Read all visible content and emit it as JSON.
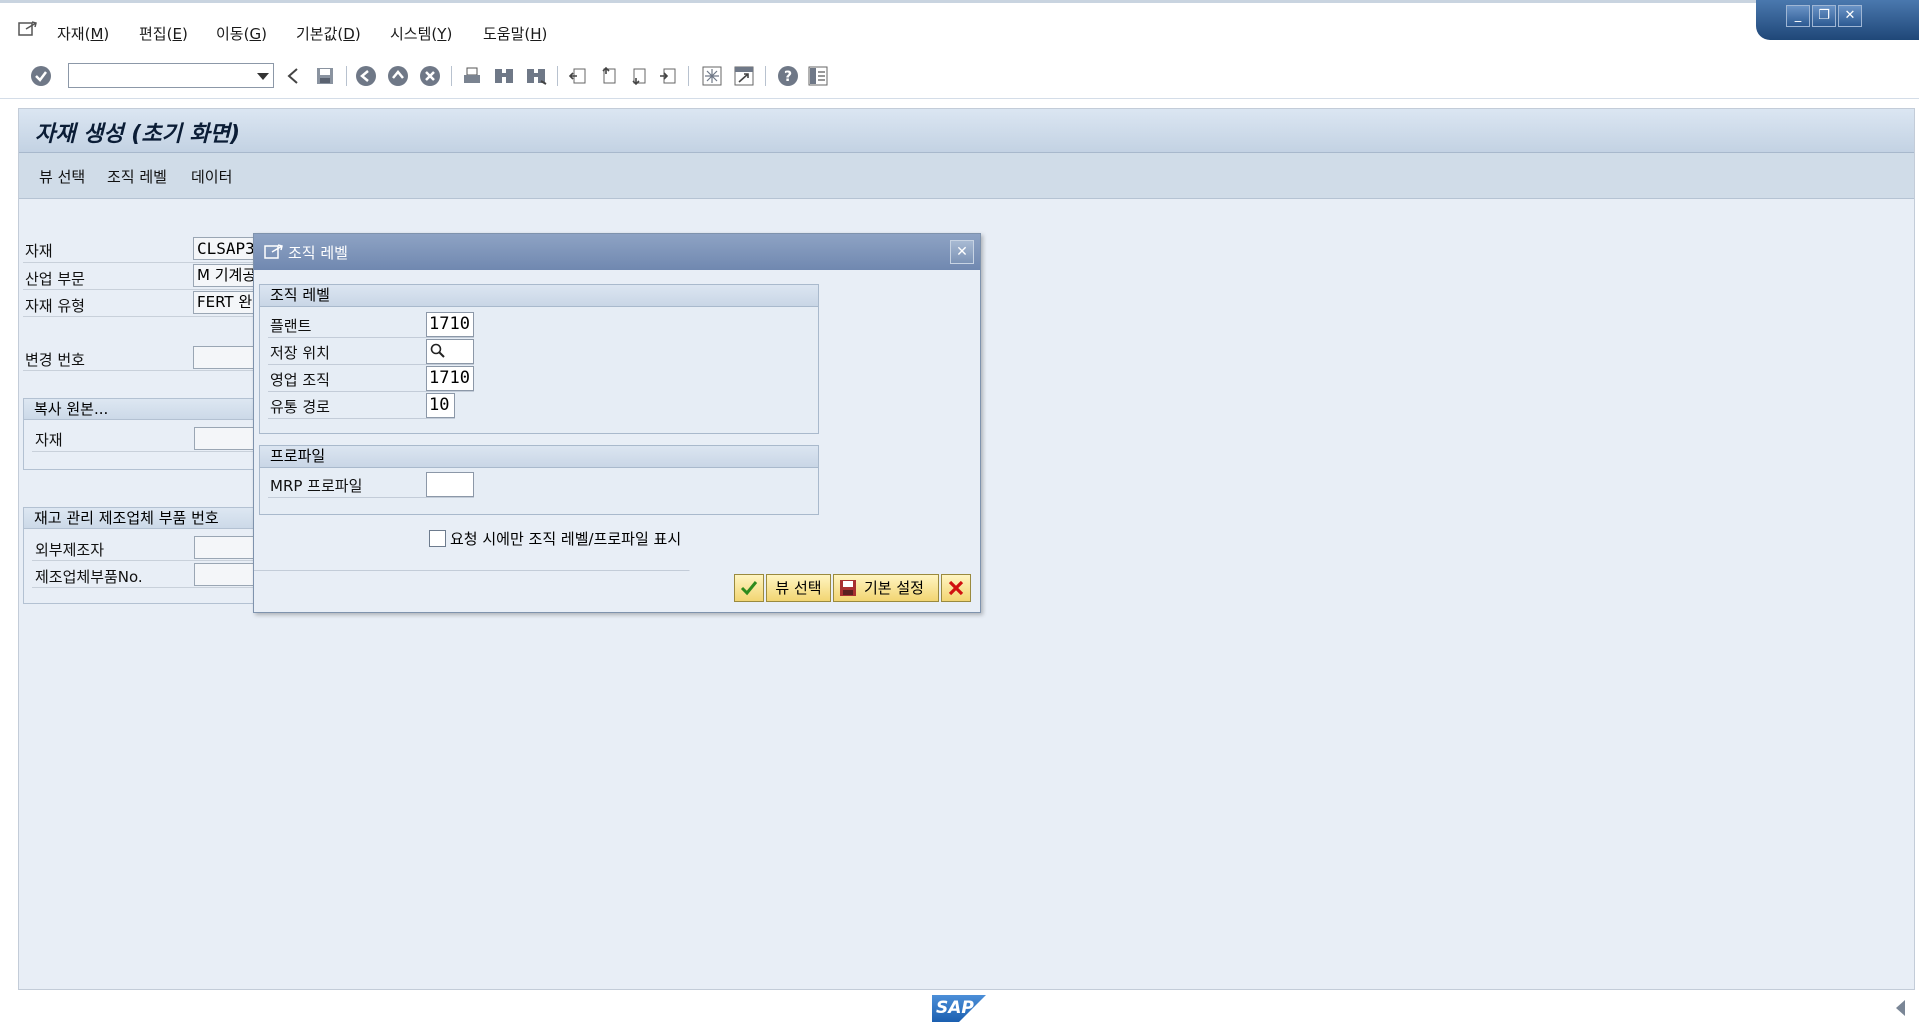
{
  "menu": {
    "items": [
      {
        "label": "자재(",
        "accel": "M",
        "end": ")"
      },
      {
        "label": "편집(",
        "accel": "E",
        "end": ")"
      },
      {
        "label": "이동(",
        "accel": "G",
        "end": ")"
      },
      {
        "label": "기본값(",
        "accel": "D",
        "end": ")"
      },
      {
        "label": "시스템(",
        "accel": "Y",
        "end": ")"
      },
      {
        "label": "도움말(",
        "accel": "H",
        "end": ")"
      }
    ]
  },
  "toolbar": {
    "command_field_value": "",
    "icons": [
      "enter-icon",
      "back-icon",
      "save-icon",
      "back-nav-icon",
      "exit-icon",
      "cancel-icon",
      "print-icon",
      "find-icon",
      "find-next-icon",
      "first-page-icon",
      "prev-page-icon",
      "next-page-icon",
      "last-page-icon",
      "new-session-icon",
      "shortcut-icon",
      "help-icon",
      "layout-icon"
    ]
  },
  "screen": {
    "title": "자재 생성 (초기 화면)",
    "app_toolbar": [
      "뷰 선택",
      "조직 레벨",
      "데이터"
    ]
  },
  "form": {
    "material_label": "자재",
    "material_value": "CLSAP3",
    "industry_label": "산업 부문",
    "industry_value": "M 기계공",
    "mat_type_label": "자재 유형",
    "mat_type_value": "FERT 완",
    "change_no_label": "변경 번호",
    "copy_group_title": "복사 원본...",
    "copy_material_label": "자재",
    "mpn_group_title": "재고 관리 제조업체 부품 번호",
    "ext_manufacturer_label": "외부제조자",
    "mfr_part_no_label": "제조업체부품No."
  },
  "dialog": {
    "title": "조직 레벨",
    "org_group_title": "조직 레벨",
    "plant_label": "플랜트",
    "plant_value": "1710",
    "storage_label": "저장 위치",
    "storage_value": "",
    "sales_org_label": "영업 조직",
    "sales_org_value": "1710",
    "dist_channel_label": "유통 경로",
    "dist_channel_value": "10",
    "profile_group_title": "프로파일",
    "mrp_profile_label": "MRP 프로파일",
    "mrp_profile_value": "",
    "checkbox_label": "요청 시에만 조직 레벨/프로파일 표시",
    "checkbox_checked": false,
    "btn_view_select": "뷰 선택",
    "btn_default_settings": "기본 설정"
  },
  "footer": {
    "logo_text": "SAP"
  },
  "colors": {
    "title_bar": "#c3d2e3",
    "dialog_title": "#7088b0",
    "button_yellow": "#f2d572",
    "cancel_red": "#d01010",
    "confirm_green": "#2e8b1e"
  }
}
